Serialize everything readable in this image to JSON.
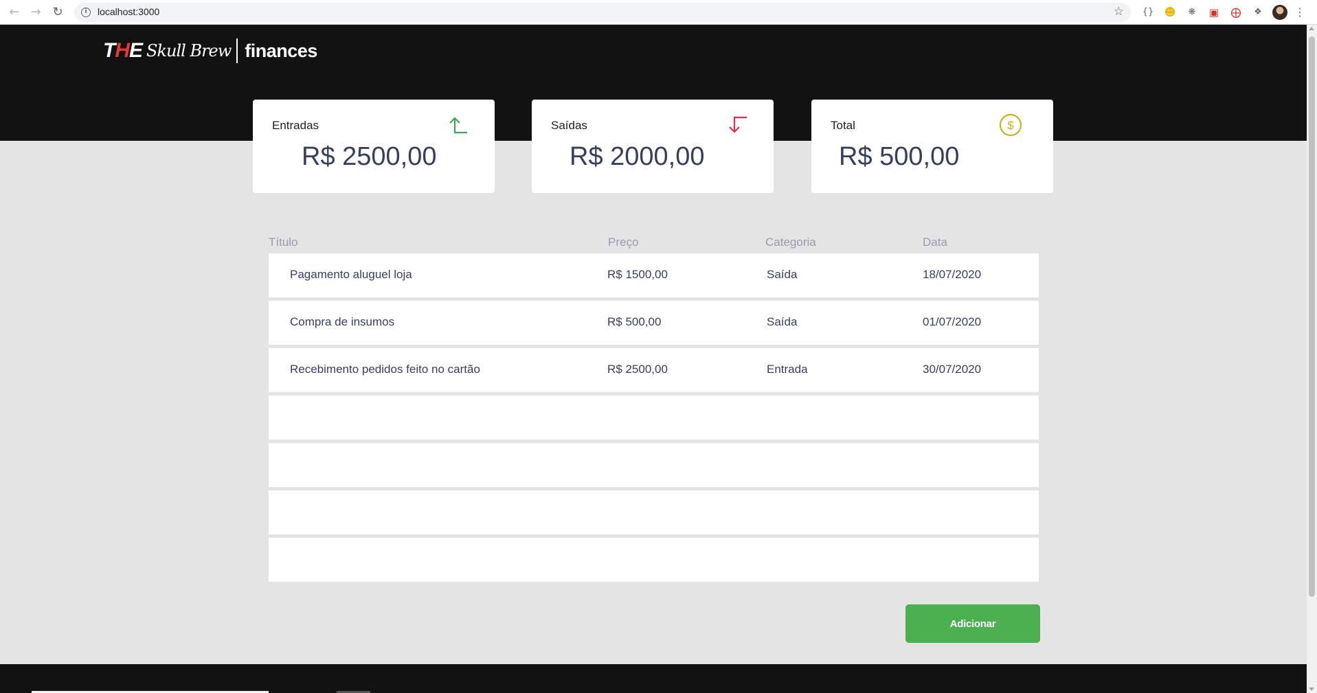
{
  "browser": {
    "url": "localhost:3000",
    "extensions": [
      "braces-extension-icon",
      "smiley-extension-icon",
      "bug-extension-icon",
      "red-extension-icon",
      "share-extension-icon",
      "puzzle-extensions-icon",
      "profile-avatar",
      "menu-icon"
    ]
  },
  "header": {
    "logo": {
      "brand_the": "THE",
      "brand_script": "Skull Brew",
      "product": "finances"
    }
  },
  "summary": {
    "income": {
      "label": "Entradas",
      "value": "R$ 2500,00",
      "icon": "arrow-up-icon",
      "color": "#3ba55c"
    },
    "outcome": {
      "label": "Saídas",
      "value": "R$ 2000,00",
      "icon": "arrow-down-icon",
      "color": "#e52e4d"
    },
    "total": {
      "label": "Total",
      "value": "R$ 500,00",
      "icon": "dollar-circle-icon",
      "color": "#c4b51a"
    }
  },
  "table": {
    "headers": {
      "title": "Título",
      "price": "Preço",
      "category": "Categoria",
      "date": "Data"
    },
    "rows": [
      {
        "title": "Pagamento aluguel loja",
        "price": "R$ 1500,00",
        "category": "Saída",
        "date": "18/07/2020"
      },
      {
        "title": "Compra de insumos",
        "price": "R$ 500,00",
        "category": "Saída",
        "date": "01/07/2020"
      },
      {
        "title": "Recebimento pedidos feito no cartão",
        "price": "R$ 2500,00",
        "category": "Entrada",
        "date": "30/07/2020"
      }
    ]
  },
  "actions": {
    "add_label": "Adicionar",
    "add_color": "#4caf50"
  }
}
